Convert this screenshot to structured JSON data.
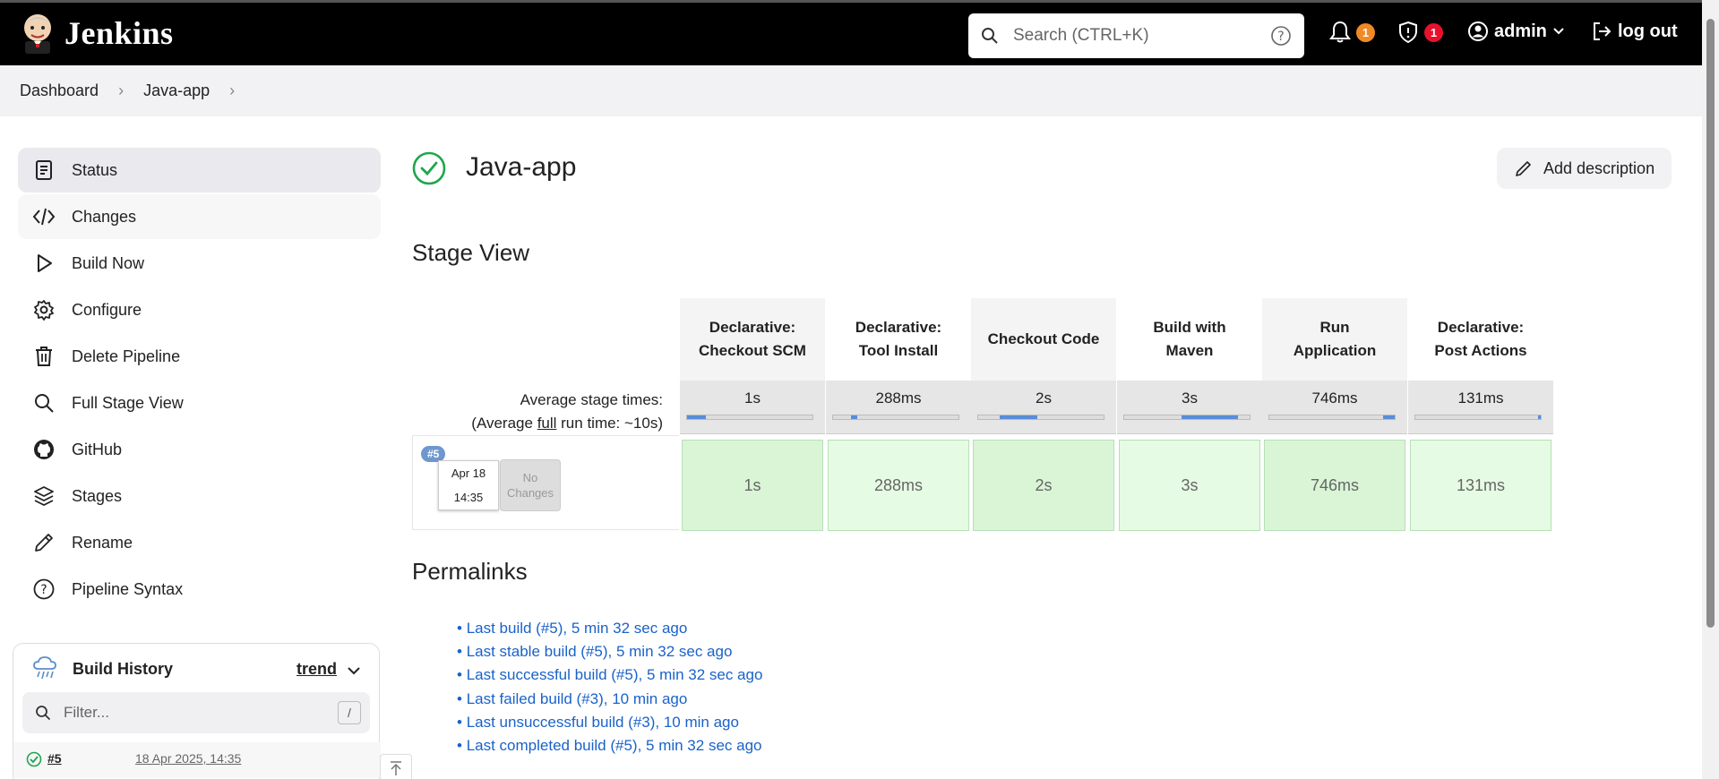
{
  "header": {
    "app_title": "Jenkins",
    "search_placeholder": "Search (CTRL+K)",
    "notifications_count": "1",
    "security_count": "1",
    "user": "admin",
    "logout": "log out"
  },
  "breadcrumb": [
    "Dashboard",
    "Java-app"
  ],
  "sidebar": {
    "items": [
      {
        "label": "Status",
        "icon": "document-icon"
      },
      {
        "label": "Changes",
        "icon": "code-icon"
      },
      {
        "label": "Build Now",
        "icon": "play-icon"
      },
      {
        "label": "Configure",
        "icon": "gear-icon"
      },
      {
        "label": "Delete Pipeline",
        "icon": "trash-icon"
      },
      {
        "label": "Full Stage View",
        "icon": "search-icon"
      },
      {
        "label": "GitHub",
        "icon": "github-icon"
      },
      {
        "label": "Stages",
        "icon": "layers-icon"
      },
      {
        "label": "Rename",
        "icon": "pencil-icon"
      },
      {
        "label": "Pipeline Syntax",
        "icon": "help-icon"
      }
    ]
  },
  "build_history": {
    "title": "Build History",
    "trend": "trend",
    "filter_placeholder": "Filter...",
    "filter_shortcut": "/",
    "builds": [
      {
        "number": "#5",
        "date": "18 Apr 2025, 14:35"
      }
    ]
  },
  "main": {
    "project_title": "Java-app",
    "add_description": "Add description",
    "stage_view_title": "Stage View",
    "avg_label_line1": "Average stage times:",
    "avg_label_prefix": "(Average ",
    "avg_label_link": "full",
    "avg_label_suffix": " run time: ~10s)",
    "stages": [
      {
        "line1": "Declarative:",
        "line2": "Checkout SCM",
        "avg": "1s",
        "bar_start": 0.0,
        "bar_fraction": 0.15,
        "run": "1s"
      },
      {
        "line1": "Declarative:",
        "line2": "Tool Install",
        "avg": "288ms",
        "bar_start": 0.14,
        "bar_fraction": 0.05,
        "run": "288ms"
      },
      {
        "line1": "Checkout Code",
        "line2": "",
        "avg": "2s",
        "bar_start": 0.17,
        "bar_fraction": 0.3,
        "run": "2s"
      },
      {
        "line1": "Build with",
        "line2": "Maven",
        "avg": "3s",
        "bar_start": 0.46,
        "bar_fraction": 0.45,
        "run": "3s"
      },
      {
        "line1": "Run",
        "line2": "Application",
        "avg": "746ms",
        "bar_start": 0.91,
        "bar_fraction": 0.09,
        "run": "746ms"
      },
      {
        "line1": "Declarative:",
        "line2": "Post Actions",
        "avg": "131ms",
        "bar_start": 0.98,
        "bar_fraction": 0.02,
        "run": "131ms"
      }
    ],
    "run": {
      "tag": "#5",
      "date": "Apr 18",
      "time": "14:35",
      "changes_line1": "No",
      "changes_line2": "Changes"
    },
    "permalinks_title": "Permalinks",
    "permalinks": [
      "Last build (#5), 5 min 32 sec ago",
      "Last stable build (#5), 5 min 32 sec ago",
      "Last successful build (#5), 5 min 32 sec ago",
      "Last failed build (#3), 10 min ago",
      "Last unsuccessful build (#3), 10 min ago",
      "Last completed build (#5), 5 min 32 sec ago"
    ]
  },
  "colors": {
    "header_bg": "#000000",
    "link": "#1a62c9",
    "success_green": "#1ea64b",
    "stage_cell": "#d9f5d6",
    "badge_orange": "#f08a24",
    "badge_red": "#e8112d"
  }
}
